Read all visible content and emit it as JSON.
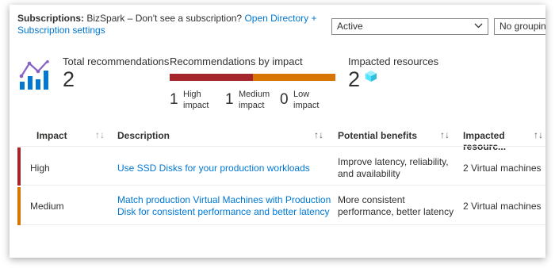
{
  "header": {
    "subscriptions_label": "Subscriptions:",
    "subscription_text": "BizSpark – Don't see a subscription?",
    "directory_link": "Open Directory + Subscription settings",
    "status_dropdown": "Active",
    "grouping_dropdown": "No grouping"
  },
  "summary": {
    "total_label": "Total recommendations",
    "total_value": "2",
    "by_impact_label": "Recommendations by impact",
    "high_count": "1",
    "high_label": "High impact",
    "medium_count": "1",
    "medium_label": "Medium impact",
    "low_count": "0",
    "low_label": "Low impact",
    "impacted_label": "Impacted resources",
    "impacted_value": "2"
  },
  "table": {
    "columns": [
      "Impact",
      "Description",
      "Potential benefits",
      "Impacted resourc..."
    ],
    "rows": [
      {
        "impact": "High",
        "description": "Use SSD Disks for your production workloads",
        "benefits": "Improve latency, reliability, and availability",
        "resources": "2 Virtual machines"
      },
      {
        "impact": "Medium",
        "description": "Match production Virtual Machines with Production Disk for consistent performance and better latency",
        "benefits": "More consistent performance, better latency",
        "resources": "2 Virtual machines"
      }
    ]
  },
  "colors": {
    "high": "#a4262c",
    "medium": "#d87500",
    "link": "#0078d4",
    "icon_purple": "#8661c5",
    "icon_blue": "#0078d4",
    "cube": "#50e6ff"
  },
  "icons": [
    "chart-icon",
    "chevron-down-icon",
    "sort-icon",
    "cube-icon"
  ]
}
